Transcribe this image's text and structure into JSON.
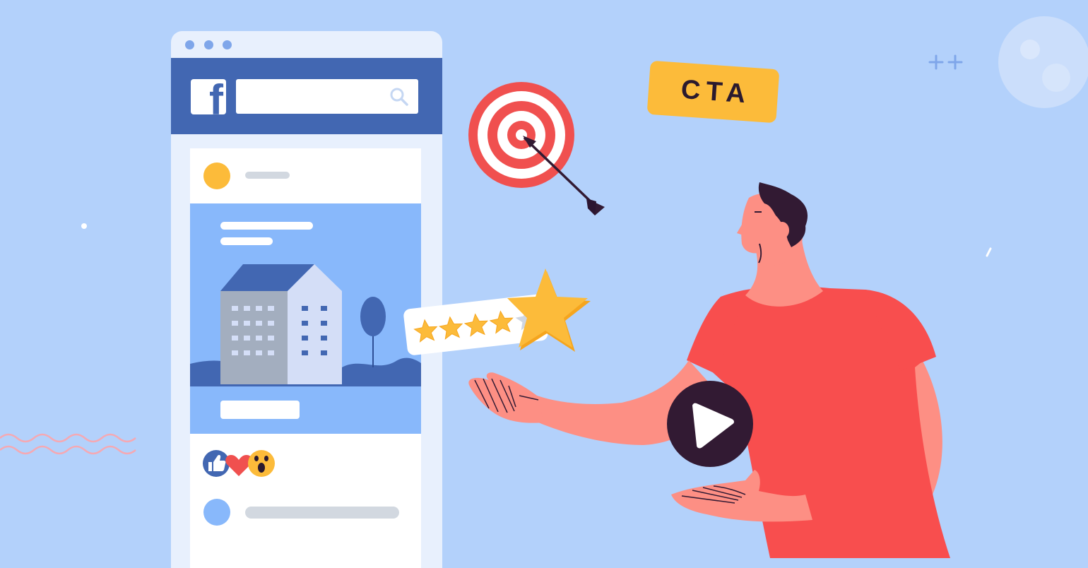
{
  "cta": {
    "label": "CTA"
  },
  "rating": {
    "filled_stars": 4,
    "total_stars": 5
  },
  "reactions": [
    "like-icon",
    "love-icon",
    "wow-icon"
  ],
  "icons": {
    "logo": "facebook-logo-icon",
    "search": "search-icon",
    "target": "target-icon",
    "arrow": "arrow-icon",
    "star": "star-icon",
    "play": "play-icon"
  },
  "colors": {
    "background": "#b3d1fb",
    "facebook_blue": "#4267b2",
    "cta_yellow": "#fcbb3a",
    "target_red": "#f0504f",
    "shirt_red": "#f84e4e",
    "skin": "#fd8f84",
    "dark": "#321a33"
  },
  "logo_letter": "f"
}
